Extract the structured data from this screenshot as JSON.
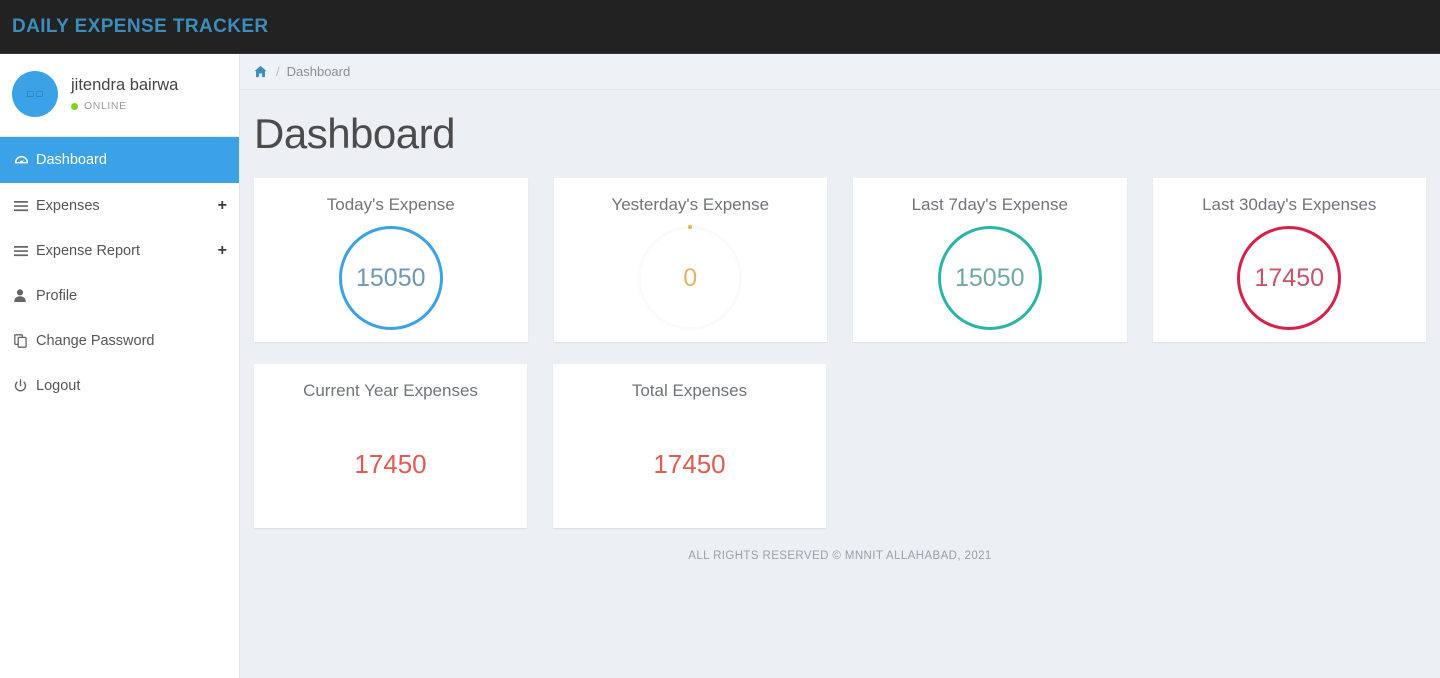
{
  "header": {
    "brand": "DAILY EXPENSE TRACKER",
    "brand_color": "#3c8dbc",
    "background": "#222222"
  },
  "sidebar": {
    "user": {
      "name": "jitendra bairwa",
      "status": "ONLINE",
      "status_color": "#7ed321",
      "avatar_icon": "broken-image-icon",
      "avatar_color": "#3ba2e8"
    },
    "items": [
      {
        "label": "Dashboard",
        "icon": "dashboard-icon",
        "active": true,
        "expandable": false,
        "plus": ""
      },
      {
        "label": "Expenses",
        "icon": "bars-icon",
        "active": false,
        "expandable": true,
        "plus": "+"
      },
      {
        "label": "Expense Report",
        "icon": "bars-icon",
        "active": false,
        "expandable": true,
        "plus": "+"
      },
      {
        "label": "Profile",
        "icon": "user-icon",
        "active": false,
        "expandable": false,
        "plus": ""
      },
      {
        "label": "Change Password",
        "icon": "copy-icon",
        "active": false,
        "expandable": false,
        "plus": ""
      },
      {
        "label": "Logout",
        "icon": "power-off-icon",
        "active": false,
        "expandable": false,
        "plus": ""
      }
    ],
    "active_color": "#3ba2e8"
  },
  "breadcrumb": {
    "home_icon": "home-icon",
    "separator": "/",
    "current": "Dashboard"
  },
  "main": {
    "page_title": "Dashboard",
    "cards_row1": [
      {
        "title": "Today's Expense",
        "value": "15050",
        "style": "ring",
        "ring_color": "#3ba2e8",
        "text_color": "#6f97b5"
      },
      {
        "title": "Yesterday's Expense",
        "value": "0",
        "style": "ring-empty",
        "ring_color": "#fafafa",
        "text_color": "#e2b661"
      },
      {
        "title": "Last 7day's Expense",
        "value": "15050",
        "style": "ring",
        "ring_color": "#2bb5a6",
        "text_color": "#6faaa2"
      },
      {
        "title": "Last 30day's Expenses",
        "value": "17450",
        "style": "ring",
        "ring_color": "#d6214a",
        "text_color": "#c8536b"
      }
    ],
    "cards_row2": [
      {
        "title": "Current Year Expenses",
        "value": "17450",
        "style": "plain",
        "text_color": "#e05b52"
      },
      {
        "title": "Total Expenses",
        "value": "17450",
        "style": "plain",
        "text_color": "#e05b52"
      }
    ]
  },
  "footer": {
    "text": "ALL RIGHTS RESERVED © MNNIT ALLAHABAD, 2021"
  }
}
